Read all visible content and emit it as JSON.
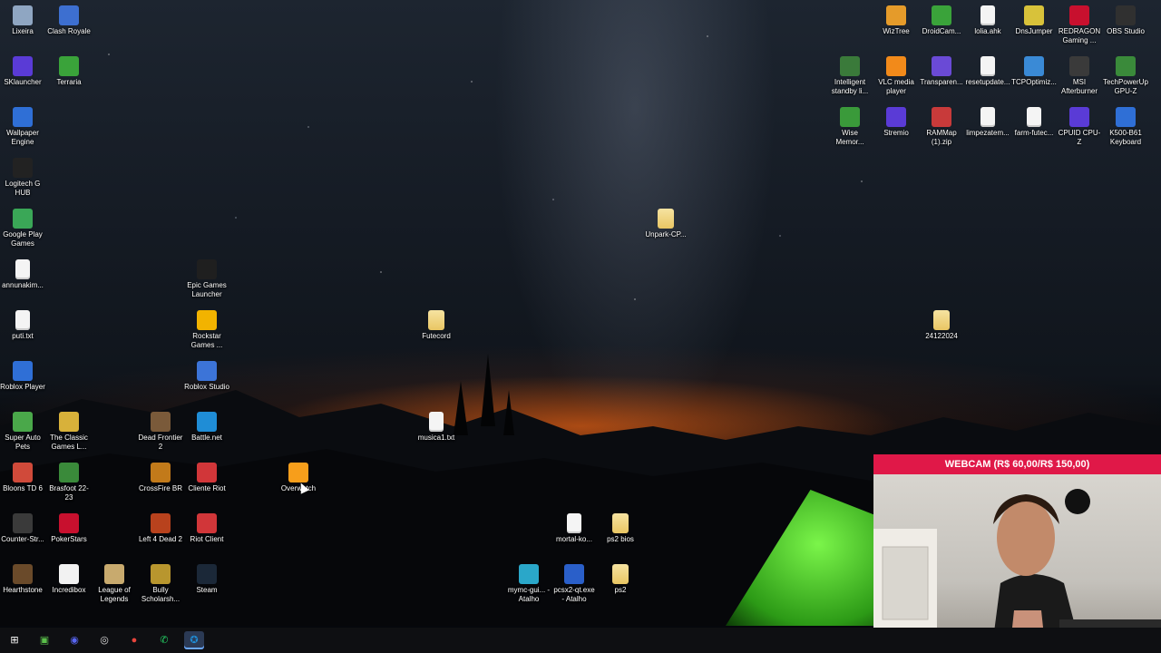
{
  "desktop_icons": [
    {
      "label": "Lixeira",
      "icon": "recycle-bin-icon",
      "color": "#8fa6c2"
    },
    {
      "label": "Clash Royale",
      "icon": "clash-royale-icon",
      "color": "#3d6fd0"
    },
    {
      "label": "SKlauncher",
      "icon": "sklauncher-icon",
      "color": "#5a3bd6"
    },
    {
      "label": "Terraria",
      "icon": "terraria-icon",
      "color": "#3aa33a"
    },
    {
      "label": "Wallpaper Engine",
      "icon": "wallpaper-engine-icon",
      "color": "#2f6fd6"
    },
    {
      "label": "Logitech G HUB",
      "icon": "logitech-icon",
      "color": "#222222"
    },
    {
      "label": "Google Play Games",
      "icon": "play-games-icon",
      "color": "#3aa757"
    },
    {
      "label": "annunakim...",
      "icon": "text-file-icon",
      "color": "#eeeeee"
    },
    {
      "label": "Epic Games Launcher",
      "icon": "epic-games-icon",
      "color": "#1f1f1f"
    },
    {
      "label": "puti.txt",
      "icon": "text-file-icon",
      "color": "#eeeeee"
    },
    {
      "label": "Rockstar Games ...",
      "icon": "rockstar-icon",
      "color": "#f2b300"
    },
    {
      "label": "Roblox Player",
      "icon": "roblox-icon",
      "color": "#2f6fd6"
    },
    {
      "label": "Roblox Studio",
      "icon": "roblox-studio-icon",
      "color": "#3c74d8"
    },
    {
      "label": "Super Auto Pets",
      "icon": "super-auto-pets-icon",
      "color": "#4aa84a"
    },
    {
      "label": "The Classic Games L...",
      "icon": "classic-games-icon",
      "color": "#d8b13a"
    },
    {
      "label": "Dead Frontier 2",
      "icon": "dead-frontier-icon",
      "color": "#7a5a3a"
    },
    {
      "label": "Battle.net",
      "icon": "battlenet-icon",
      "color": "#1f8dd6"
    },
    {
      "label": "Bloons TD 6",
      "icon": "bloons-icon",
      "color": "#d04a3a"
    },
    {
      "label": "Brasfoot 22-23",
      "icon": "brasfoot-icon",
      "color": "#3a8a3a"
    },
    {
      "label": "CrossFire BR",
      "icon": "crossfire-icon",
      "color": "#c27a1a"
    },
    {
      "label": "Cliente Riot",
      "icon": "riot-icon",
      "color": "#d13639"
    },
    {
      "label": "Overwatch",
      "icon": "overwatch-icon",
      "color": "#f79e1b"
    },
    {
      "label": "Counter-Str...",
      "icon": "counter-strike-icon",
      "color": "#3a3a3a"
    },
    {
      "label": "PokerStars",
      "icon": "pokerstars-icon",
      "color": "#c8102e"
    },
    {
      "label": "Left 4 Dead 2",
      "icon": "left4dead-icon",
      "color": "#b8421d"
    },
    {
      "label": "Riot Client",
      "icon": "riot-client-icon",
      "color": "#d13639"
    },
    {
      "label": "Hearthstone",
      "icon": "hearthstone-icon",
      "color": "#6a4a2a"
    },
    {
      "label": "Incredibox",
      "icon": "incredibox-icon",
      "color": "#f2f2f2"
    },
    {
      "label": "League of Legends",
      "icon": "league-icon",
      "color": "#c8aa6e"
    },
    {
      "label": "Bully Scholarsh...",
      "icon": "bully-icon",
      "color": "#b8962e"
    },
    {
      "label": "Steam",
      "icon": "steam-icon",
      "color": "#1b2838"
    },
    {
      "label": "Futecord",
      "icon": "folder-icon",
      "color": "#e9c663"
    },
    {
      "label": "musica1.txt",
      "icon": "text-file-icon",
      "color": "#eeeeee"
    },
    {
      "label": "Unpark-CP...",
      "icon": "folder-zip-icon",
      "color": "#e9c663"
    },
    {
      "label": "mortal-ko...",
      "icon": "text-file-icon",
      "color": "#eeeeee"
    },
    {
      "label": "ps2 bios",
      "icon": "folder-icon",
      "color": "#e9c663"
    },
    {
      "label": "mymc-gui... - Atalho",
      "icon": "mymc-icon",
      "color": "#2aa7c9"
    },
    {
      "label": "pcsx2-qt.exe - Atalho",
      "icon": "pcsx2-icon",
      "color": "#2a5fc9"
    },
    {
      "label": "ps2",
      "icon": "folder-icon",
      "color": "#e9c663"
    },
    {
      "label": "24122024",
      "icon": "folder-icon",
      "color": "#e9c663"
    },
    {
      "label": "WizTree",
      "icon": "wiztree-icon",
      "color": "#e59b2a"
    },
    {
      "label": "DroidCam...",
      "icon": "droidcam-icon",
      "color": "#3aa33a"
    },
    {
      "label": "lolia.ahk",
      "icon": "ahk-file-icon",
      "color": "#f4f4f4"
    },
    {
      "label": "DnsJumper",
      "icon": "dnsjumper-icon",
      "color": "#d8c23a"
    },
    {
      "label": "REDRAGON Gaming ...",
      "icon": "redragon-icon",
      "color": "#c8102e"
    },
    {
      "label": "OBS Studio",
      "icon": "obs-icon",
      "color": "#303030"
    },
    {
      "label": "Intelligent standby li...",
      "icon": "standby-icon",
      "color": "#3a7a3a"
    },
    {
      "label": "VLC media player",
      "icon": "vlc-icon",
      "color": "#f28a1a"
    },
    {
      "label": "Transparen...",
      "icon": "transparent-icon",
      "color": "#6a4ad6"
    },
    {
      "label": "resetupdate...",
      "icon": "generic-file-icon",
      "color": "#f4f4f4"
    },
    {
      "label": "TCPOptimiz...",
      "icon": "tcpoptimizer-icon",
      "color": "#3a8ad6"
    },
    {
      "label": "MSI Afterburner",
      "icon": "msi-icon",
      "color": "#3a3a3a"
    },
    {
      "label": "TechPowerUp GPU-Z",
      "icon": "gpuz-icon",
      "color": "#3a8a3a"
    },
    {
      "label": "Wise Memor...",
      "icon": "wise-memory-icon",
      "color": "#3a9a3a"
    },
    {
      "label": "Stremio",
      "icon": "stremio-icon",
      "color": "#5a3bd6"
    },
    {
      "label": "RAMMap (1).zip",
      "icon": "zip-icon",
      "color": "#c83a3a"
    },
    {
      "label": "limpezatem...",
      "icon": "generic-file-icon",
      "color": "#f4f4f4"
    },
    {
      "label": "farm-futec...",
      "icon": "ahk-file-icon",
      "color": "#f4f4f4"
    },
    {
      "label": "CPUID CPU-Z",
      "icon": "cpuz-icon",
      "color": "#5a3bd6"
    },
    {
      "label": "K500-B61 Keyboard",
      "icon": "keyboard-icon",
      "color": "#2f6fd6"
    }
  ],
  "webcam": {
    "header": "WEBCAM (R$ 60,00/R$ 150,00)"
  },
  "taskbar": {
    "items": [
      {
        "name": "start-icon",
        "glyph": "⊞",
        "color": "#ffffff",
        "active": false
      },
      {
        "name": "app-green-icon",
        "glyph": "▣",
        "color": "#5bbf4a",
        "active": false
      },
      {
        "name": "discord-icon",
        "glyph": "◉",
        "color": "#5865f2",
        "active": false
      },
      {
        "name": "obs-icon",
        "glyph": "◎",
        "color": "#dddddd",
        "active": false
      },
      {
        "name": "chrome-icon",
        "glyph": "●",
        "color": "#e8453c",
        "active": false
      },
      {
        "name": "whatsapp-icon",
        "glyph": "✆",
        "color": "#25d366",
        "active": false
      },
      {
        "name": "battlenet-icon",
        "glyph": "✪",
        "color": "#1f8dd6",
        "active": true
      }
    ]
  }
}
